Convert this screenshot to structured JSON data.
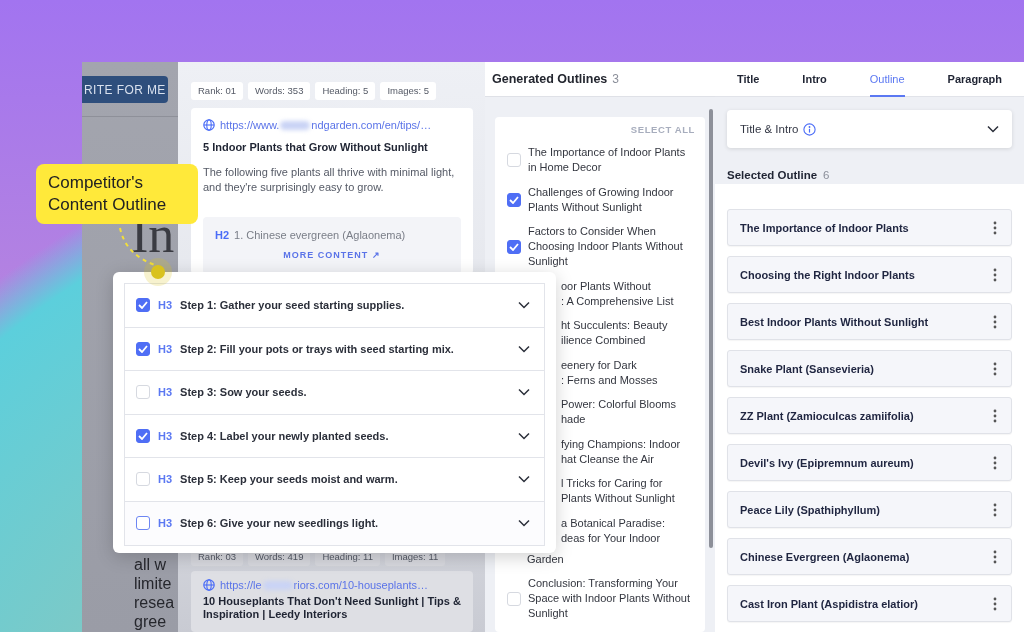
{
  "callout": {
    "text": "Competitor's Content Outline"
  },
  "editor": {
    "button": "RITE FOR ME",
    "heading": "In",
    "lines": [
      "all w",
      "limite",
      "resea",
      "gree"
    ]
  },
  "competitors": [
    {
      "stats": [
        "Rank: 01",
        "Words: 353",
        "Heading: 5",
        "Images: 5"
      ],
      "url_start": "https://www.",
      "url_end": "ndgarden.com/en/tips/…",
      "title": "5 Indoor Plants that Grow Without Sunlight",
      "snippet": "The following five plants all thrive with minimal light, and they're surprisingly easy to grow.",
      "heading": {
        "tag": "H2",
        "text": "1. Chinese evergreen (Aglaonema)"
      },
      "more": "MORE CONTENT ↗"
    },
    {
      "stats": [
        "Rank: 03",
        "Words: 419",
        "Heading: 11",
        "Images: 11"
      ],
      "url_start": "https://le",
      "url_end": "riors.com/10-houseplants…",
      "title": "10 Houseplants That Don't Need Sunlight | Tips & Inspiration | Leedy Interiors"
    }
  ],
  "generated_outlines": {
    "title": "Generated Outlines",
    "count": "3",
    "select_all": "SELECT ALL",
    "items": [
      {
        "kind": "full",
        "checked": false,
        "text": "The Importance of Indoor Plants in Home Decor"
      },
      {
        "kind": "full",
        "checked": true,
        "text": "Challenges of Growing Indoor Plants Without Sunlight"
      },
      {
        "kind": "full",
        "checked": true,
        "text": "Factors to Consider When Choosing Indoor Plants Without Sunlight"
      },
      {
        "kind": "covered",
        "lines": [
          {
            "text": "oor Plants Without",
            "covered": true
          },
          {
            "text": ": A Comprehensive List",
            "covered": true
          }
        ]
      },
      {
        "kind": "covered",
        "lines": [
          {
            "text": "ht Succulents: Beauty",
            "covered": true
          },
          {
            "text": "ilience Combined",
            "covered": true
          }
        ]
      },
      {
        "kind": "covered",
        "lines": [
          {
            "text": "eenery for Dark",
            "covered": true
          },
          {
            "text": ": Ferns and Mosses",
            "covered": true
          }
        ]
      },
      {
        "kind": "covered",
        "lines": [
          {
            "text": "Power: Colorful Blooms",
            "covered": true
          },
          {
            "text": "hade",
            "covered": true
          }
        ]
      },
      {
        "kind": "covered",
        "lines": [
          {
            "text": "fying Champions: Indoor",
            "covered": true
          },
          {
            "text": "hat Cleanse the Air",
            "covered": true
          }
        ]
      },
      {
        "kind": "covered",
        "lines": [
          {
            "text": "l Tricks for Caring for",
            "covered": true
          },
          {
            "text": "Plants Without Sunlight",
            "covered": true
          }
        ]
      },
      {
        "kind": "covered",
        "lines": [
          {
            "text": "a Botanical Paradise:",
            "covered": true
          },
          {
            "text": "deas for Your Indoor",
            "covered": true
          },
          {
            "text": "Garden",
            "covered": false
          }
        ]
      },
      {
        "kind": "full",
        "checked": false,
        "text": "Conclusion: Transforming Your Space with Indoor Plants Without Sunlight"
      }
    ]
  },
  "popup": {
    "rows": [
      {
        "checked": true,
        "focused": false,
        "tag": "H3",
        "text": "Step 1: Gather your seed starting supplies."
      },
      {
        "checked": true,
        "focused": false,
        "tag": "H3",
        "text": "Step 2: Fill your pots or trays with seed starting mix."
      },
      {
        "checked": false,
        "focused": false,
        "tag": "H3",
        "text": "Step 3: Sow your seeds."
      },
      {
        "checked": true,
        "focused": false,
        "tag": "H3",
        "text": "Step 4: Label your newly planted seeds."
      },
      {
        "checked": false,
        "focused": false,
        "tag": "H3",
        "text": "Step 5: Keep your seeds moist and warm."
      },
      {
        "checked": false,
        "focused": true,
        "tag": "H3",
        "text": "Step 6: Give your new seedlings light."
      }
    ]
  },
  "right_panel": {
    "tabs": [
      {
        "label": "Title",
        "selected": false
      },
      {
        "label": "Intro",
        "selected": false
      },
      {
        "label": "Outline",
        "selected": true
      },
      {
        "label": "Paragraph",
        "selected": false
      }
    ],
    "dropdown": {
      "value": "Title & Intro"
    },
    "selected_title": "Selected Outline",
    "selected_count": "6",
    "items": [
      "The Importance of Indoor Plants",
      "Choosing the Right Indoor Plants",
      "Best Indoor Plants Without Sunlight",
      "Snake Plant (Sansevieria)",
      "ZZ Plant (Zamioculcas zamiifolia)",
      "Devil's Ivy (Epipremnum aureum)",
      "Peace Lily (Spathiphyllum)",
      "Chinese Evergreen (Aglaonema)",
      "Cast Iron Plant (Aspidistra elatior)"
    ]
  }
}
